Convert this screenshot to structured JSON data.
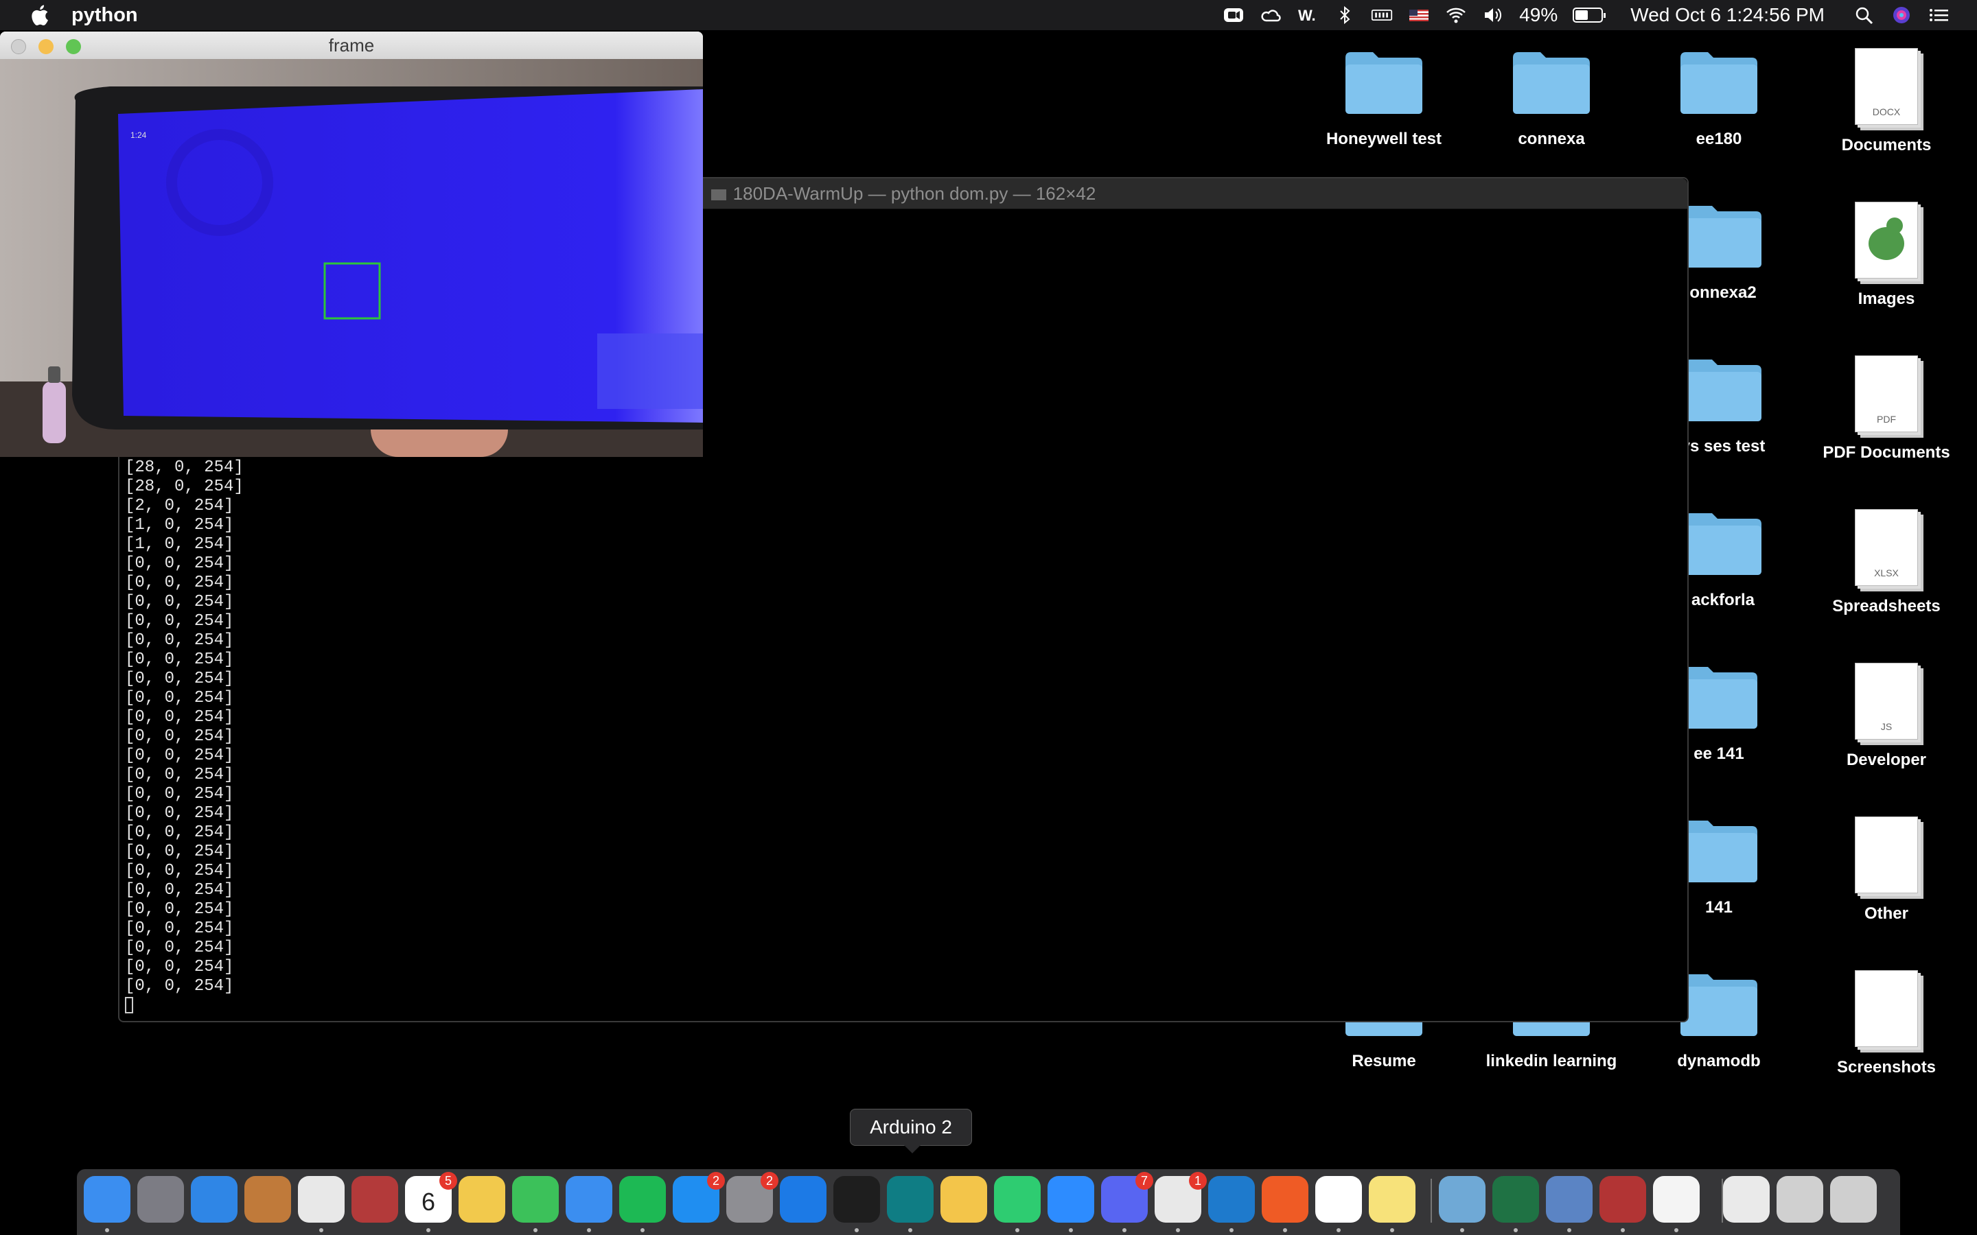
{
  "menubar": {
    "app_name": "python",
    "battery_percent": "49%",
    "datetime": "Wed Oct 6  1:24:56 PM",
    "status_icons": [
      "zoom-icon",
      "creative-cloud-icon",
      "word-icon",
      "bluetooth-icon",
      "memory-icon",
      "us-flag-icon",
      "wifi-icon",
      "volume-icon"
    ],
    "battery_level": 0.49
  },
  "frame_window": {
    "title": "frame",
    "phone_time": "1:24"
  },
  "terminal": {
    "title": "180DA-WarmUp — python dom.py — 162×42",
    "lines": [
      "[28, 0, 254]",
      "[28, 0, 254]",
      "[2, 0, 254]",
      "[1, 0, 254]",
      "[1, 0, 254]",
      "[0, 0, 254]",
      "[0, 0, 254]",
      "[0, 0, 254]",
      "[0, 0, 254]",
      "[0, 0, 254]",
      "[0, 0, 254]",
      "[0, 0, 254]",
      "[0, 0, 254]",
      "[0, 0, 254]",
      "[0, 0, 254]",
      "[0, 0, 254]",
      "[0, 0, 254]",
      "[0, 0, 254]",
      "[0, 0, 254]",
      "[0, 0, 254]",
      "[0, 0, 254]",
      "[0, 0, 254]",
      "[0, 0, 254]",
      "[0, 0, 254]",
      "[0, 0, 254]",
      "[0, 0, 254]",
      "[0, 0, 254]",
      "[0, 0, 254]"
    ]
  },
  "desktop": {
    "items": [
      {
        "label": "Honeywell test",
        "kind": "folder"
      },
      {
        "label": "connexa",
        "kind": "folder"
      },
      {
        "label": "ee180",
        "kind": "folder"
      },
      {
        "label": "Documents",
        "kind": "doc",
        "tag": "DOCX"
      },
      {
        "label": "onnexa2",
        "kind": "folder"
      },
      {
        "label": "Images",
        "kind": "image"
      },
      {
        "label": "ys ses test",
        "kind": "folder"
      },
      {
        "label": "PDF Documents",
        "kind": "doc",
        "tag": "PDF"
      },
      {
        "label": "ackforla",
        "kind": "folder"
      },
      {
        "label": "Spreadsheets",
        "kind": "doc",
        "tag": "XLSX"
      },
      {
        "label": "ee 141",
        "kind": "folder"
      },
      {
        "label": "Developer",
        "kind": "doc",
        "tag": "JS"
      },
      {
        "label": "141",
        "kind": "folder"
      },
      {
        "label": "Other",
        "kind": "doc",
        "tag": ""
      },
      {
        "label": "Resume",
        "kind": "folder"
      },
      {
        "label": "linkedin learning",
        "kind": "folder"
      },
      {
        "label": "dynamodb",
        "kind": "folder"
      },
      {
        "label": "Screenshots",
        "kind": "doc",
        "tag": ""
      }
    ]
  },
  "dock": {
    "tooltip": "Arduino 2",
    "apps": [
      {
        "name": "finder-icon",
        "color": "#3b8ef0"
      },
      {
        "name": "launchpad-icon",
        "color": "#7c7c84"
      },
      {
        "name": "safari-icon",
        "color": "#2f86e6"
      },
      {
        "name": "calculator-icon",
        "color": "#c07a3a"
      },
      {
        "name": "chrome-icon",
        "color": "#e8e8e8"
      },
      {
        "name": "photo-booth-icon",
        "color": "#b33a3a"
      },
      {
        "name": "calendar-icon",
        "color": "#ffffff",
        "badge": "5",
        "text": "6"
      },
      {
        "name": "photos-icon",
        "color": "#f2c94c"
      },
      {
        "name": "facetime-icon",
        "color": "#3cc15a"
      },
      {
        "name": "messages-icon",
        "color": "#3b8ef0"
      },
      {
        "name": "spotify-icon",
        "color": "#1db954"
      },
      {
        "name": "app-store-icon",
        "color": "#1f8ef1",
        "badge": "2"
      },
      {
        "name": "system-preferences-icon",
        "color": "#8e8e93",
        "badge": "2"
      },
      {
        "name": "xcode-icon",
        "color": "#1c7ae6"
      },
      {
        "name": "terminal-icon",
        "color": "#1e1e1e"
      },
      {
        "name": "arduino-icon",
        "color": "#0f7d84"
      },
      {
        "name": "cyberduck-icon",
        "color": "#f3c54a"
      },
      {
        "name": "whatsapp-icon",
        "color": "#2ecc71"
      },
      {
        "name": "zoom-icon",
        "color": "#2d8cff"
      },
      {
        "name": "discord-icon",
        "color": "#5865f2",
        "badge": "7"
      },
      {
        "name": "slack-icon",
        "color": "#e8e8e8",
        "badge": "1"
      },
      {
        "name": "vscode-icon",
        "color": "#1e7acc"
      },
      {
        "name": "postman-icon",
        "color": "#ef5b25"
      },
      {
        "name": "notion-icon",
        "color": "#ffffff"
      },
      {
        "name": "stickies-icon",
        "color": "#f7e27a"
      },
      {
        "name": "preview-icon",
        "color": "#6fa9d6"
      },
      {
        "name": "excel-icon",
        "color": "#1f7244"
      },
      {
        "name": "bird-app-icon",
        "color": "#5b84c4"
      },
      {
        "name": "dictionary-icon",
        "color": "#b23434"
      },
      {
        "name": "document-icon",
        "color": "#f4f4f4"
      },
      {
        "name": "downloads-stack-icon",
        "color": "#eaeaea"
      },
      {
        "name": "screenshot-stack-icon",
        "color": "#d0d0d0"
      },
      {
        "name": "trash-icon",
        "color": "#cfcfcf"
      }
    ]
  }
}
